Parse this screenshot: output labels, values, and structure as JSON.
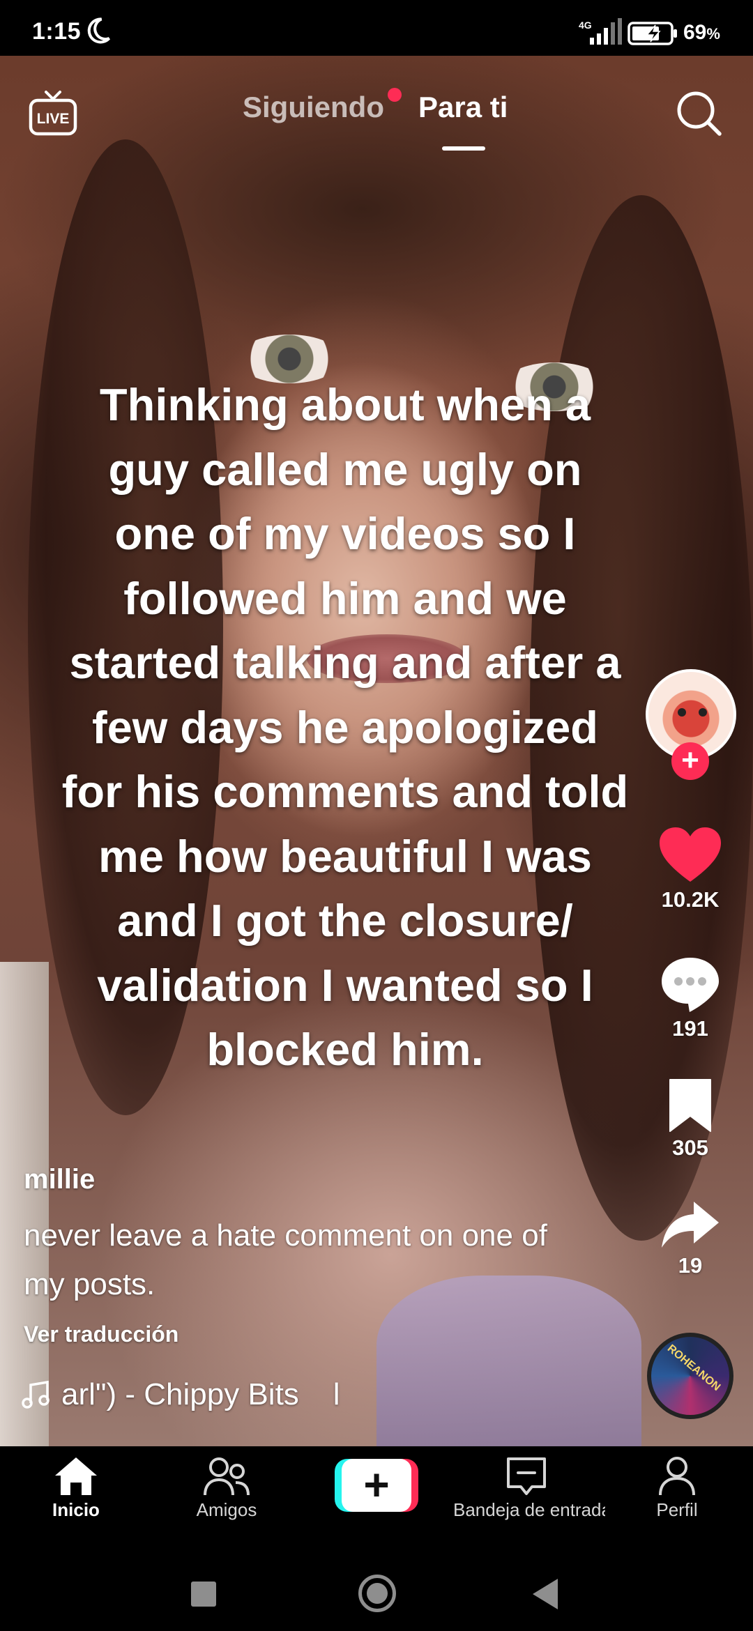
{
  "status_bar": {
    "time": "1:15",
    "network": "4G",
    "battery_pct": "69",
    "battery_suffix": "%"
  },
  "top_nav": {
    "live_icon": "live-tv-icon",
    "following_label": "Siguiendo",
    "for_you_label": "Para ti",
    "following_has_new": true,
    "active_tab": "Para ti",
    "search_icon": "search-icon"
  },
  "video": {
    "overlay_text": "Thinking about when a\nguy called me ugly on\none of my videos so I\nfollowed him  and we\nstarted talking and after a\nfew days he apologized\nfor his comments and told\nme how beautiful I was\nand I got the closure/\nvalidation I wanted so I\nblocked him."
  },
  "actions": {
    "likes": "10.2K",
    "comments": "191",
    "saves": "305",
    "shares": "19",
    "like_color": "#fe2c55",
    "follow_icon": "plus-icon"
  },
  "post": {
    "username": "millie",
    "caption": "never leave a hate comment on one of my posts.",
    "translate_label": "Ver traducción",
    "music": "arl\") - Chippy Bits    l"
  },
  "disc_label": "ROHEANON",
  "bottom_nav": {
    "home": "Inicio",
    "friends": "Amigos",
    "inbox": "Bandeja de entrada",
    "profile": "Perfil",
    "create_symbol": "+"
  },
  "colors": {
    "accent_red": "#fe2c55",
    "accent_cyan": "#25f4ee"
  }
}
